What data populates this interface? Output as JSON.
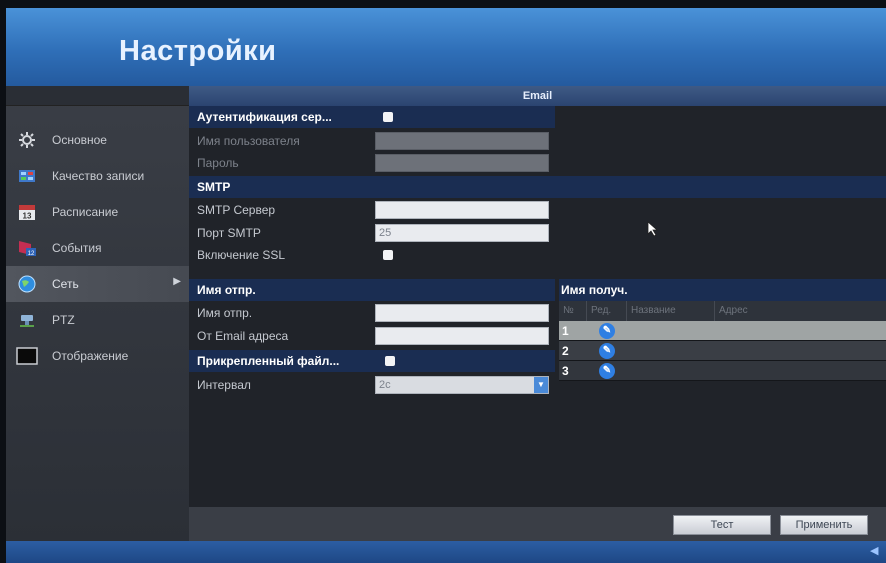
{
  "header": {
    "title": "Настройки"
  },
  "tab": {
    "title": "Email"
  },
  "sidebar": {
    "items": [
      {
        "label": "Основное",
        "icon": "gear-icon"
      },
      {
        "label": "Качество записи",
        "icon": "record-quality-icon"
      },
      {
        "label": "Расписание",
        "icon": "calendar-icon"
      },
      {
        "label": "События",
        "icon": "events-icon"
      },
      {
        "label": "Сеть",
        "icon": "network-globe-icon"
      },
      {
        "label": "PTZ",
        "icon": "ptz-icon"
      },
      {
        "label": "Отображение",
        "icon": "monitor-icon"
      }
    ]
  },
  "auth": {
    "label": "Аутентификация сер...",
    "checked": true,
    "username_label": "Имя пользователя",
    "username_value": "",
    "password_label": "Пароль",
    "password_value": ""
  },
  "smtp": {
    "section": "SMTP",
    "server_label": "SMTP Сервер",
    "server_value": "",
    "port_label": "Порт SMTP",
    "port_value": "25",
    "ssl_label": "Включение SSL",
    "ssl_checked": true
  },
  "sender": {
    "section": "Имя отпр.",
    "name_label": "Имя отпр.",
    "name_value": "",
    "from_label": "От Email адреса",
    "from_value": ""
  },
  "attachment": {
    "label": "Прикрепленный файл...",
    "checked": true,
    "interval_label": "Интервал",
    "interval_value": "2с"
  },
  "recipients": {
    "section": "Имя получ.",
    "columns": [
      "№",
      "Ред.",
      "Название",
      "Адрес"
    ],
    "rows": [
      {
        "no": "1",
        "selected": true
      },
      {
        "no": "2",
        "selected": false
      },
      {
        "no": "3",
        "selected": false
      }
    ]
  },
  "buttons": {
    "test": "Тест",
    "apply": "Применить"
  },
  "colors": {
    "header": "#3a7fc8",
    "section": "#1a2d52",
    "edit": "#2f7fe3"
  }
}
